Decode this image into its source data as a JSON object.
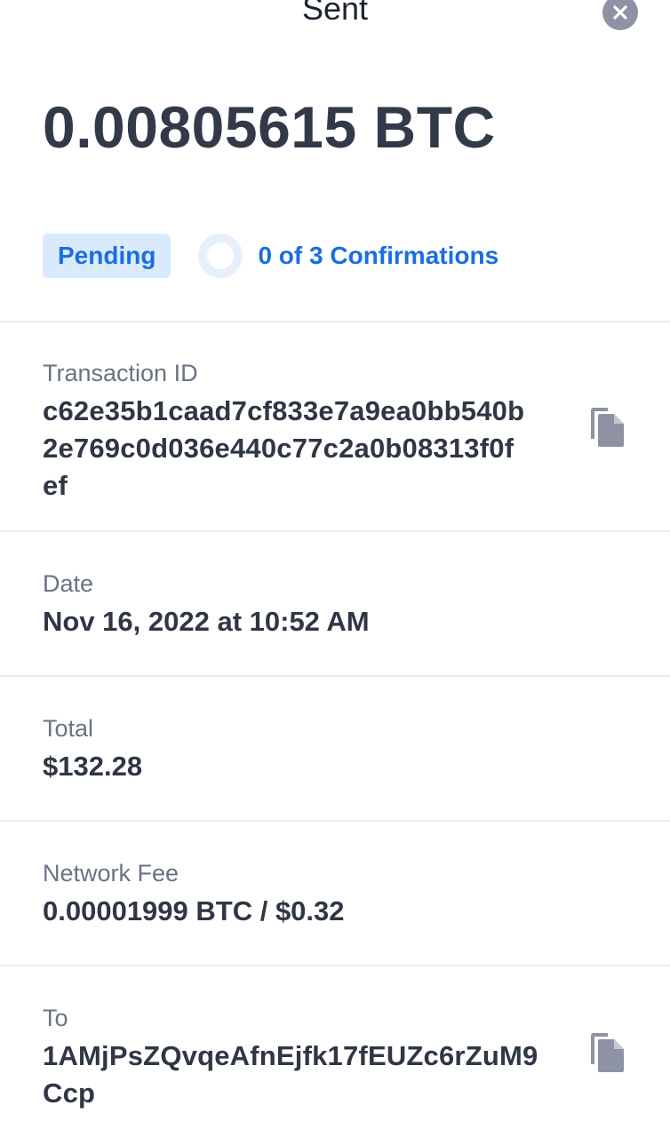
{
  "header": {
    "title": "Sent",
    "close_icon": "close-icon"
  },
  "amount": "0.00805615 BTC",
  "status": {
    "badge": "Pending",
    "confirmations": "0 of 3 Confirmations",
    "confirmations_progress": 0
  },
  "transaction": {
    "label": "Transaction ID",
    "lines": [
      "c62e35b1caad7cf833e7a9ea0bb540b",
      "2e769c0d036e440c77c2a0b08313f0f",
      "ef"
    ],
    "copy_icon": "copy-icon"
  },
  "date": {
    "label": "Date",
    "value": "Nov 16, 2022 at 10:52 AM"
  },
  "total": {
    "label": "Total",
    "value": "$132.28"
  },
  "network_fee": {
    "label": "Network Fee",
    "value": "0.00001999 BTC / $0.32"
  },
  "to": {
    "label": "To",
    "lines": [
      "1AMjPsZQvqeAfnEjfk17fEUZc6rZuM9",
      "Ccp"
    ],
    "copy_icon": "copy-icon"
  },
  "colors": {
    "accent": "#1a6ee0",
    "badge_bg": "#d8eafb",
    "text": "#2f3644",
    "muted": "#6a7284",
    "divider": "#e8eaee",
    "icon": "#8d93a3"
  }
}
